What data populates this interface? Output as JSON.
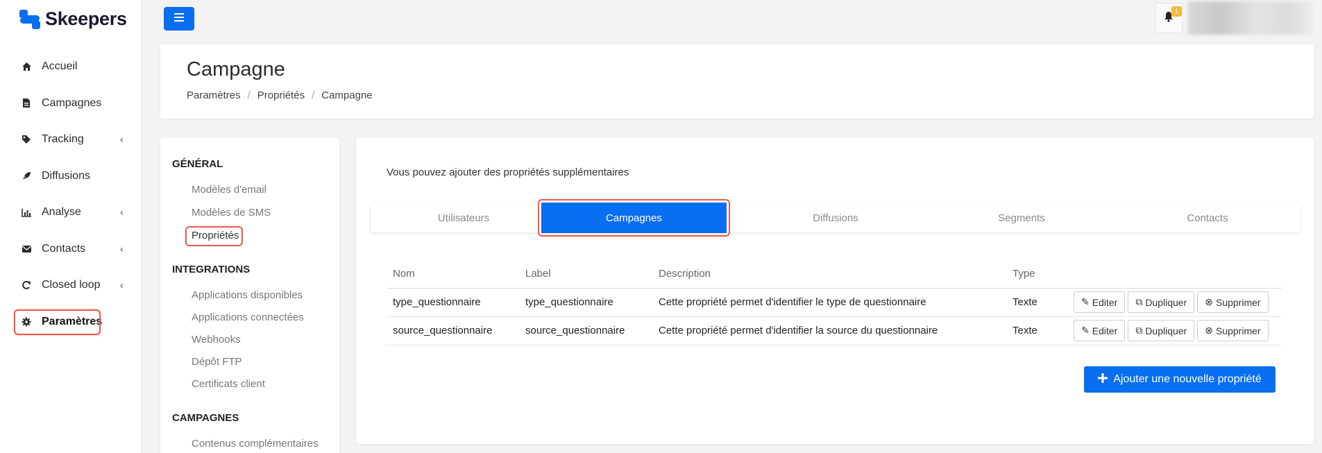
{
  "brand": {
    "name": "Skeepers",
    "color": "#0a6ef0"
  },
  "sidebar": {
    "items": [
      {
        "label": "Accueil",
        "icon": "home-icon"
      },
      {
        "label": "Campagnes",
        "icon": "file-icon"
      },
      {
        "label": "Tracking",
        "icon": "tag-icon"
      },
      {
        "label": "Diffusions",
        "icon": "rocket-icon"
      },
      {
        "label": "Analyse",
        "icon": "bar-chart-icon"
      },
      {
        "label": "Contacts",
        "icon": "envelope-icon"
      },
      {
        "label": "Closed loop",
        "icon": "refresh-icon"
      },
      {
        "label": "Paramètres",
        "icon": "gear-icon"
      }
    ]
  },
  "topbar": {
    "notification_count": "1"
  },
  "header": {
    "title": "Campagne",
    "breadcrumb": [
      "Paramètres",
      "Propriétés",
      "Campagne"
    ]
  },
  "settings_nav": {
    "general": {
      "title": "GÉNÉRAL",
      "links": [
        "Modèles d'email",
        "Modèles de SMS",
        "Propriétés"
      ]
    },
    "integrations": {
      "title": "INTEGRATIONS",
      "links": [
        "Applications disponibles",
        "Applications connectées",
        "Webhooks",
        "Dépôt FTP",
        "Certificats client"
      ]
    },
    "campagnes": {
      "title": "CAMPAGNES",
      "links": [
        "Contenus complémentaires"
      ]
    }
  },
  "main": {
    "intro": "Vous pouvez ajouter des propriétés supplémentaires",
    "tabs": [
      "Utilisateurs",
      "Campagnes",
      "Diffusions",
      "Segments",
      "Contacts"
    ],
    "active_tab": "Campagnes",
    "table": {
      "headers": [
        "Nom",
        "Label",
        "Description",
        "Type"
      ],
      "rows": [
        {
          "nom": "type_questionnaire",
          "label": "type_questionnaire",
          "description": "Cette propriété permet d'identifier le type de questionnaire",
          "type": "Texte"
        },
        {
          "nom": "source_questionnaire",
          "label": "source_questionnaire",
          "description": "Cette propriété permet d'identifier la source du questionnaire",
          "type": "Texte"
        }
      ],
      "actions": {
        "edit": "Editer",
        "duplicate": "Dupliquer",
        "delete": "Supprimer"
      }
    },
    "add_button": "Ajouter une nouvelle propriété"
  }
}
